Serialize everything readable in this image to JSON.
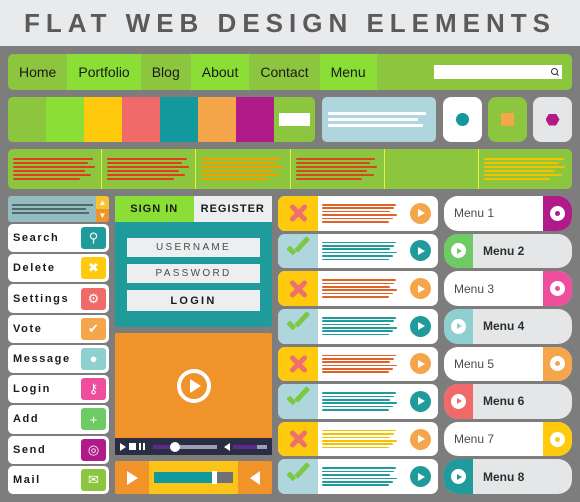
{
  "header": {
    "title": "FLAT WEB DESIGN ELEMENTS"
  },
  "nav": {
    "items": [
      {
        "label": "Home",
        "style": "plain"
      },
      {
        "label": "Portfolio",
        "style": "alt"
      },
      {
        "label": "Blog",
        "style": "plain"
      },
      {
        "label": "About",
        "style": "alt"
      },
      {
        "label": "Contact",
        "style": "plain"
      },
      {
        "label": "Menu",
        "style": "alt"
      }
    ],
    "search": {
      "value": "",
      "placeholder": "",
      "icon": "search-icon"
    },
    "bar_color": "#8cc63e",
    "alt_color": "#8ade35"
  },
  "palette": {
    "swatches": [
      "#8cc63e",
      "#8ade35",
      "#ffc90e",
      "#f06a6a",
      "#11999e",
      "#f5a54a",
      "#b01b89"
    ],
    "field_color": "#ffffff"
  },
  "infobox": {
    "bg": "#aed6dc",
    "lines": 3
  },
  "tiles": [
    {
      "name": "circle-tile",
      "bg": "#ffffff",
      "shape": "circle",
      "shape_color": "#11999e"
    },
    {
      "name": "square-tile",
      "bg": "#8cc63e",
      "shape": "square",
      "shape_color": "#f5a54a"
    },
    {
      "name": "hex-tile",
      "bg": "#e4e6e8",
      "shape": "hexagon",
      "shape_color": "#b01b89"
    }
  ],
  "band": {
    "bg": "#8cc63e",
    "columns": [
      {
        "text_color": "#e03c1f",
        "lines": 6
      },
      {
        "text_color": "#e03c1f",
        "lines": 6
      },
      {
        "text_color": "#f4a000",
        "lines": 6
      },
      {
        "text_color": "#d44a1a",
        "lines": 6
      },
      {
        "text_color": "#8cc63e",
        "lines": 0
      },
      {
        "text_color": "#f4c300",
        "lines": 6
      }
    ]
  },
  "sidebar": {
    "updown": {
      "bg": "#94bbbe",
      "up_icon": "arrow-up-icon",
      "down_icon": "arrow-down-icon",
      "up_color": "#f7c331",
      "down_color": "#f0932b"
    },
    "buttons": [
      {
        "label": "Search",
        "icon": "search-icon",
        "glyph": "⚲",
        "color": "#1f9b9b"
      },
      {
        "label": "Delete",
        "icon": "close-x-icon",
        "glyph": "✖",
        "color": "#ffc90e"
      },
      {
        "label": "Settings",
        "icon": "gear-icon",
        "glyph": "⚙",
        "color": "#f06a6a"
      },
      {
        "label": "Vote",
        "icon": "check-icon",
        "glyph": "✔",
        "color": "#f5a54a"
      },
      {
        "label": "Message",
        "icon": "chat-icon",
        "glyph": "●",
        "color": "#8ecfd0"
      },
      {
        "label": "Login",
        "icon": "key-icon",
        "glyph": "⚷",
        "color": "#ee4e9b"
      },
      {
        "label": "Add",
        "icon": "plus-icon",
        "glyph": "+",
        "color": "#6ecb63"
      },
      {
        "label": "Send",
        "icon": "send-icon",
        "glyph": "◎",
        "color": "#b01b89"
      },
      {
        "label": "Mail",
        "icon": "envelope-icon",
        "glyph": "✉",
        "color": "#8cc63e"
      }
    ]
  },
  "login": {
    "bg": "#1f9b9b",
    "tabs": [
      {
        "label": "SIGN IN",
        "active": true
      },
      {
        "label": "REGISTER",
        "active": false
      }
    ],
    "username_placeholder": "USERNAME",
    "password_placeholder": "PASSWORD",
    "submit_label": "LOGIN"
  },
  "video": {
    "bg": "#f0932b",
    "play_icon": "play-icon",
    "controls": [
      "play-icon",
      "stop-icon",
      "pause-icon"
    ],
    "progress_percent": 28,
    "volume_percent": 72,
    "bar_bg": "#2b2d42",
    "fill_color": "#5b2c8d"
  },
  "audio": {
    "bg": "#f0932b",
    "mid_bg": "#fcc419",
    "play_icon": "play-icon",
    "speaker_icon": "speaker-icon",
    "progress_percent": 76,
    "fill_color": "#11999e"
  },
  "statuslist": {
    "rows": [
      {
        "status": "x",
        "mark_bg": "#ffc90e",
        "text_color": "#e0622a",
        "arrow_color": "#f5a54a"
      },
      {
        "status": "check",
        "mark_bg": "#aed6dc",
        "text_color": "#1f9b9b",
        "arrow_color": "#1f9b9b"
      },
      {
        "status": "x",
        "mark_bg": "#ffc90e",
        "text_color": "#e0622a",
        "arrow_color": "#f5a54a"
      },
      {
        "status": "check",
        "mark_bg": "#aed6dc",
        "text_color": "#1f9b9b",
        "arrow_color": "#1f9b9b"
      },
      {
        "status": "x",
        "mark_bg": "#ffc90e",
        "text_color": "#e0622a",
        "arrow_color": "#f5a54a"
      },
      {
        "status": "check",
        "mark_bg": "#aed6dc",
        "text_color": "#1f9b9b",
        "arrow_color": "#1f9b9b"
      },
      {
        "status": "x",
        "mark_bg": "#ffc90e",
        "text_color": "#f4c300",
        "arrow_color": "#f5a54a"
      },
      {
        "status": "check",
        "mark_bg": "#aed6dc",
        "text_color": "#1f9b9b",
        "arrow_color": "#1f9b9b"
      }
    ]
  },
  "menulist": {
    "items": [
      {
        "label": "Menu 1",
        "chip_color": "#b01b89",
        "chip_side": "right",
        "icon": "record-icon"
      },
      {
        "label": "Menu 2",
        "chip_color": "#6ecb63",
        "chip_side": "left",
        "icon": "play-icon"
      },
      {
        "label": "Menu 3",
        "chip_color": "#ee4e9b",
        "chip_side": "right",
        "icon": "record-icon"
      },
      {
        "label": "Menu 4",
        "chip_color": "#8ecfd0",
        "chip_side": "left",
        "icon": "play-icon"
      },
      {
        "label": "Menu 5",
        "chip_color": "#f5a54a",
        "chip_side": "right",
        "icon": "record-icon"
      },
      {
        "label": "Menu 6",
        "chip_color": "#f06a6a",
        "chip_side": "left",
        "icon": "play-icon"
      },
      {
        "label": "Menu 7",
        "chip_color": "#ffc90e",
        "chip_side": "right",
        "icon": "record-icon"
      },
      {
        "label": "Menu 8",
        "chip_color": "#1f9b9b",
        "chip_side": "left",
        "icon": "play-icon"
      }
    ]
  }
}
